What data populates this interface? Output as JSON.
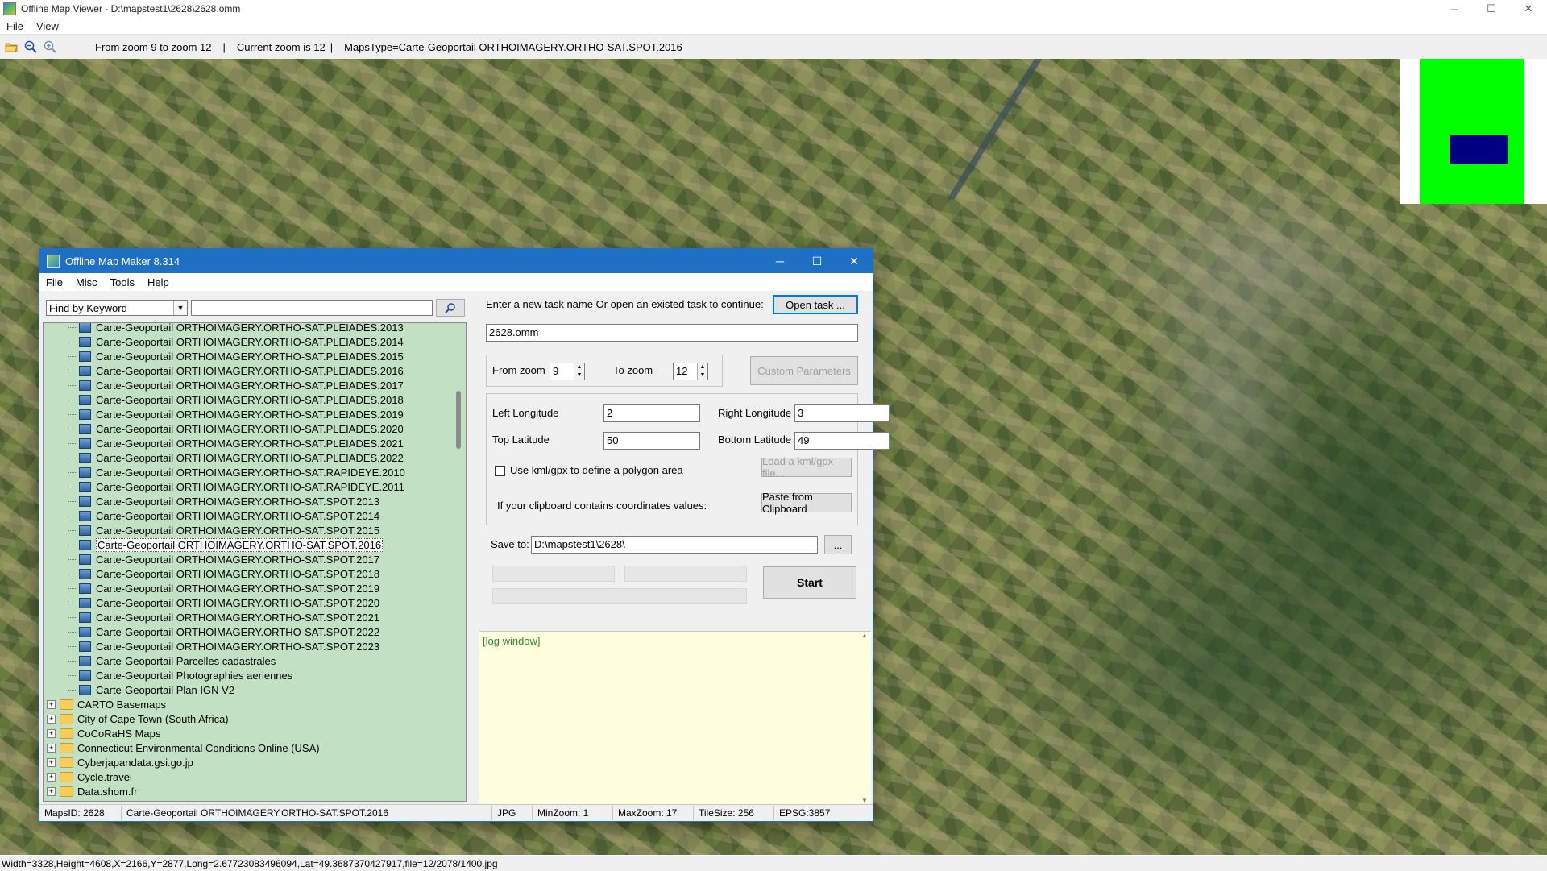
{
  "window": {
    "title": "Offline Map Viewer - D:\\mapstest1\\2628\\2628.omm",
    "controls": {
      "minimize": "─",
      "maximize": "☐",
      "close": "✕"
    }
  },
  "menu": {
    "file": "File",
    "view": "View"
  },
  "toolbar": {
    "icons": [
      "open-folder-icon",
      "zoom-out-icon",
      "zoom-in-icon"
    ],
    "zoom_range": "From zoom 9 to zoom 12",
    "current_zoom": "Current zoom is 12",
    "maps_type": "MapsType=Carte-Geoportail ORTHOIMAGERY.ORTHO-SAT.SPOT.2016",
    "separator": "|"
  },
  "status_bar": "Width=3328,Height=4608,X=2166,Y=2877,Long=2.67723083496094,Lat=49.3687370427917,file=12/2078/1400.jpg",
  "colors": {
    "minimap_bg": "#00ff00",
    "minimap_view": "#000080",
    "dialog_title": "#1f6fc5",
    "tree_bg": "#c2e0c4",
    "log_bg": "#ffffe0"
  },
  "dialog": {
    "title": "Offline Map Maker 8.314",
    "menu": [
      "File",
      "Misc",
      "Tools",
      "Help"
    ],
    "search": {
      "mode": "Find by Keyword",
      "value": ""
    },
    "tree": {
      "children": [
        "Carte-Geoportail ORTHOIMAGERY.ORTHO-SAT.PLEIADES.2013",
        "Carte-Geoportail ORTHOIMAGERY.ORTHO-SAT.PLEIADES.2014",
        "Carte-Geoportail ORTHOIMAGERY.ORTHO-SAT.PLEIADES.2015",
        "Carte-Geoportail ORTHOIMAGERY.ORTHO-SAT.PLEIADES.2016",
        "Carte-Geoportail ORTHOIMAGERY.ORTHO-SAT.PLEIADES.2017",
        "Carte-Geoportail ORTHOIMAGERY.ORTHO-SAT.PLEIADES.2018",
        "Carte-Geoportail ORTHOIMAGERY.ORTHO-SAT.PLEIADES.2019",
        "Carte-Geoportail ORTHOIMAGERY.ORTHO-SAT.PLEIADES.2020",
        "Carte-Geoportail ORTHOIMAGERY.ORTHO-SAT.PLEIADES.2021",
        "Carte-Geoportail ORTHOIMAGERY.ORTHO-SAT.PLEIADES.2022",
        "Carte-Geoportail ORTHOIMAGERY.ORTHO-SAT.RAPIDEYE.2010",
        "Carte-Geoportail ORTHOIMAGERY.ORTHO-SAT.RAPIDEYE.2011",
        "Carte-Geoportail ORTHOIMAGERY.ORTHO-SAT.SPOT.2013",
        "Carte-Geoportail ORTHOIMAGERY.ORTHO-SAT.SPOT.2014",
        "Carte-Geoportail ORTHOIMAGERY.ORTHO-SAT.SPOT.2015",
        "Carte-Geoportail ORTHOIMAGERY.ORTHO-SAT.SPOT.2016",
        "Carte-Geoportail ORTHOIMAGERY.ORTHO-SAT.SPOT.2017",
        "Carte-Geoportail ORTHOIMAGERY.ORTHO-SAT.SPOT.2018",
        "Carte-Geoportail ORTHOIMAGERY.ORTHO-SAT.SPOT.2019",
        "Carte-Geoportail ORTHOIMAGERY.ORTHO-SAT.SPOT.2020",
        "Carte-Geoportail ORTHOIMAGERY.ORTHO-SAT.SPOT.2021",
        "Carte-Geoportail ORTHOIMAGERY.ORTHO-SAT.SPOT.2022",
        "Carte-Geoportail ORTHOIMAGERY.ORTHO-SAT.SPOT.2023",
        "Carte-Geoportail Parcelles cadastrales",
        "Carte-Geoportail Photographies aeriennes",
        "Carte-Geoportail Plan IGN V2"
      ],
      "selected": "Carte-Geoportail ORTHOIMAGERY.ORTHO-SAT.SPOT.2016",
      "folders": [
        "CARTO Basemaps",
        "City of Cape Town (South Africa)",
        "CoCoRaHS Maps",
        "Connecticut Environmental Conditions Online (USA)",
        "Cyberjapandata.gsi.go.jp",
        "Cycle.travel",
        "Data.shom.fr"
      ]
    },
    "task_prompt": "Enter a new task name Or open an existed task to continue:",
    "open_task": "Open task ...",
    "task_name": "2628.omm",
    "from_zoom_label": "From zoom",
    "from_zoom": "9",
    "to_zoom_label": "To zoom",
    "to_zoom": "12",
    "custom_params": "Custom Parameters",
    "left_lon_label": "Left Longitude",
    "left_lon": "2",
    "right_lon_label": "Right Longitude",
    "right_lon": "3",
    "top_lat_label": "Top Latitude",
    "top_lat": "50",
    "bottom_lat_label": "Bottom Latitude",
    "bottom_lat": "49",
    "kml_checkbox": "Use kml/gpx to define a polygon area",
    "load_kml": "Load a kml/gpx file...",
    "clipboard_prompt": "If your clipboard contains coordinates values:",
    "paste_clipboard": "Paste from Clipboard",
    "save_to_label": "Save to:",
    "save_to": "D:\\mapstest1\\2628\\",
    "browse": "...",
    "start": "Start",
    "log": "[log window]",
    "status": {
      "maps_id": "MapsID: 2628",
      "map_name": "Carte-Geoportail ORTHOIMAGERY.ORTHO-SAT.SPOT.2016",
      "format": "JPG",
      "min_zoom": "MinZoom: 1",
      "max_zoom": "MaxZoom: 17",
      "tile_size": "TileSize: 256",
      "epsg": "EPSG:3857"
    }
  }
}
